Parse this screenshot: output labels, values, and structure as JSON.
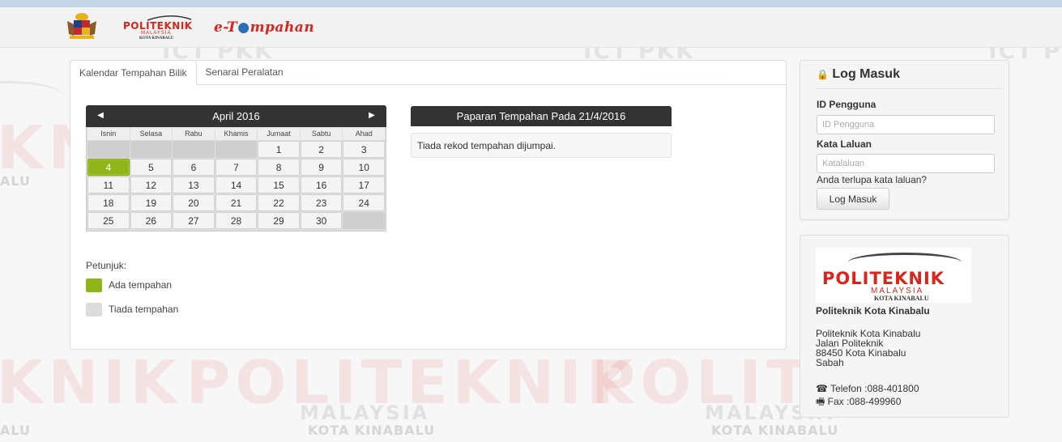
{
  "header": {
    "brand_name": "POLITEKNIK",
    "brand_sub": "MALAYSIA",
    "brand_sub2": "KOTA KINABALU",
    "app_title_pre": "e-T",
    "app_title_post": "mpahan"
  },
  "watermark": {
    "ict": "ICT PKK",
    "big1": "KNIK",
    "big2": "POLITEKNIK",
    "big3": "POLITE",
    "malaysia": "MALAYSIA",
    "kota": "KOTA KINABALU",
    "alu": "ALU",
    "ia": "IA"
  },
  "tabs": [
    {
      "label": "Kalendar Tempahan Bilik",
      "active": true
    },
    {
      "label": "Senarai Peralatan",
      "active": false
    }
  ],
  "calendar": {
    "month_label": "April 2016",
    "prev_icon": "◀",
    "next_icon": "▶",
    "weekdays": [
      "Isnin",
      "Selasa",
      "Rabu",
      "Khamis",
      "Jumaat",
      "Sabtu",
      "Ahad"
    ],
    "leading_blanks": 4,
    "days": [
      1,
      2,
      3,
      4,
      5,
      6,
      7,
      8,
      9,
      10,
      11,
      12,
      13,
      14,
      15,
      16,
      17,
      18,
      19,
      20,
      21,
      22,
      23,
      24,
      25,
      26,
      27,
      28,
      29,
      30
    ],
    "trailing_blanks": 1,
    "booked_days": [
      4
    ]
  },
  "legend": {
    "title": "Petunjuk:",
    "booked_label": "Ada tempahan",
    "free_label": "Tiada tempahan",
    "booked_color": "#8fb518",
    "free_color": "#dcdcdc"
  },
  "booking_view": {
    "title": "Paparan Tempahan Pada 21/4/2016",
    "message": "Tiada rekod tempahan dijumpai."
  },
  "login": {
    "title": "Log Masuk",
    "lock_icon": "🔒",
    "user_label": "ID Pengguna",
    "user_placeholder": "ID Pengguna",
    "pass_label": "Kata Laluan",
    "pass_placeholder": "Katalaluan",
    "forgot": "Anda terlupa kata laluan?",
    "button": "Log Masuk"
  },
  "info": {
    "logo_name": "POLITEKNIK",
    "logo_sub": "MALAYSIA",
    "logo_sub2": "KOTA KINABALU",
    "name": "Politeknik Kota Kinabalu",
    "address": [
      "Politeknik Kota Kinabalu",
      "Jalan Politeknik",
      "88450 Kota Kinabalu",
      "Sabah"
    ],
    "phone": "Telefon :088-401800",
    "fax": "Fax :088-499960",
    "phone_icon": "☎",
    "fax_icon": "🖷"
  }
}
